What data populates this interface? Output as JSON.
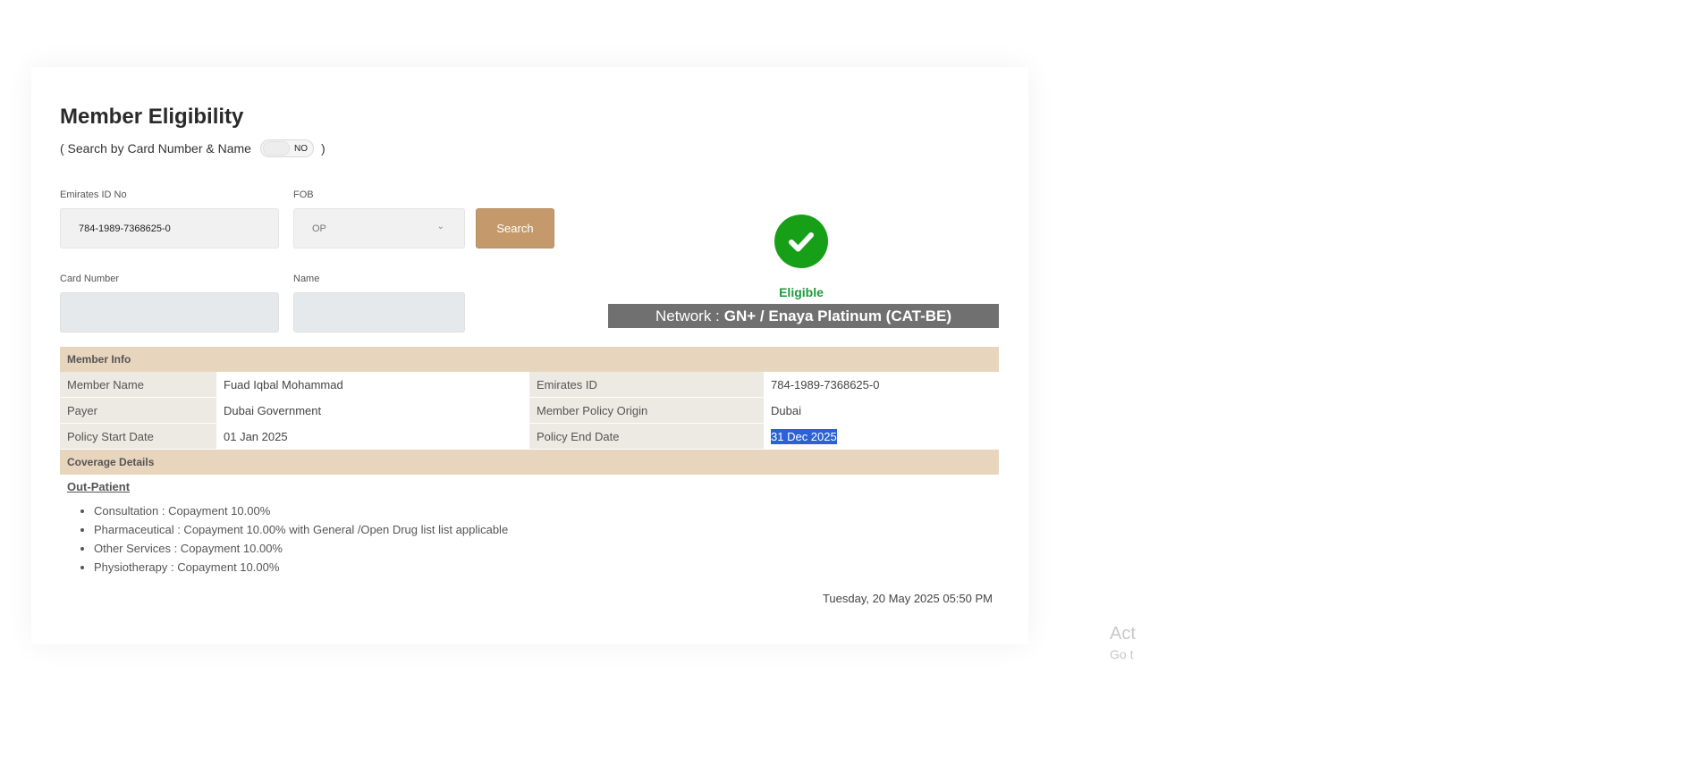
{
  "page": {
    "title": "Member Eligibility",
    "subtitle_prefix": "( Search by Card Number & Name",
    "subtitle_suffix": ")",
    "toggle_state": "NO"
  },
  "form": {
    "emirates_id_label": "Emirates ID No",
    "emirates_id_value": "784-1989-7368625-0",
    "fob_label": "FOB",
    "fob_value": "OP",
    "search_button": "Search",
    "card_number_label": "Card Number",
    "card_number_value": "",
    "name_label": "Name",
    "name_value": ""
  },
  "status": {
    "label": "Eligible",
    "network_prefix": "Network :",
    "network_value": "GN+ / Enaya Platinum (CAT-BE)",
    "icon": "check-circle-icon",
    "color": "#17a017"
  },
  "member_info": {
    "header": "Member Info",
    "rows": [
      {
        "k1": "Member Name",
        "v1": "Fuad Iqbal Mohammad",
        "k2": "Emirates ID",
        "v2": "784-1989-7368625-0"
      },
      {
        "k1": "Payer",
        "v1": "Dubai Government",
        "k2": "Member Policy Origin",
        "v2": "Dubai"
      },
      {
        "k1": "Policy Start Date",
        "v1": "01 Jan 2025",
        "k2": "Policy End Date",
        "v2": "31 Dec 2025"
      }
    ]
  },
  "coverage": {
    "header": "Coverage Details",
    "category": "Out-Patient",
    "items": [
      "Consultation : Copayment 10.00%",
      "Pharmaceutical : Copayment 10.00% with General /Open Drug list list applicable",
      "Other Services : Copayment 10.00%",
      "Physiotherapy : Copayment 10.00%"
    ]
  },
  "timestamp": "Tuesday, 20 May 2025 05:50 PM",
  "watermark": {
    "line1": "Act",
    "line2": "Go t"
  },
  "colors": {
    "accent_button": "#c49a6c",
    "section_header": "#e8d5bd",
    "network_bar": "#707070",
    "selection": "#2b63d6"
  }
}
